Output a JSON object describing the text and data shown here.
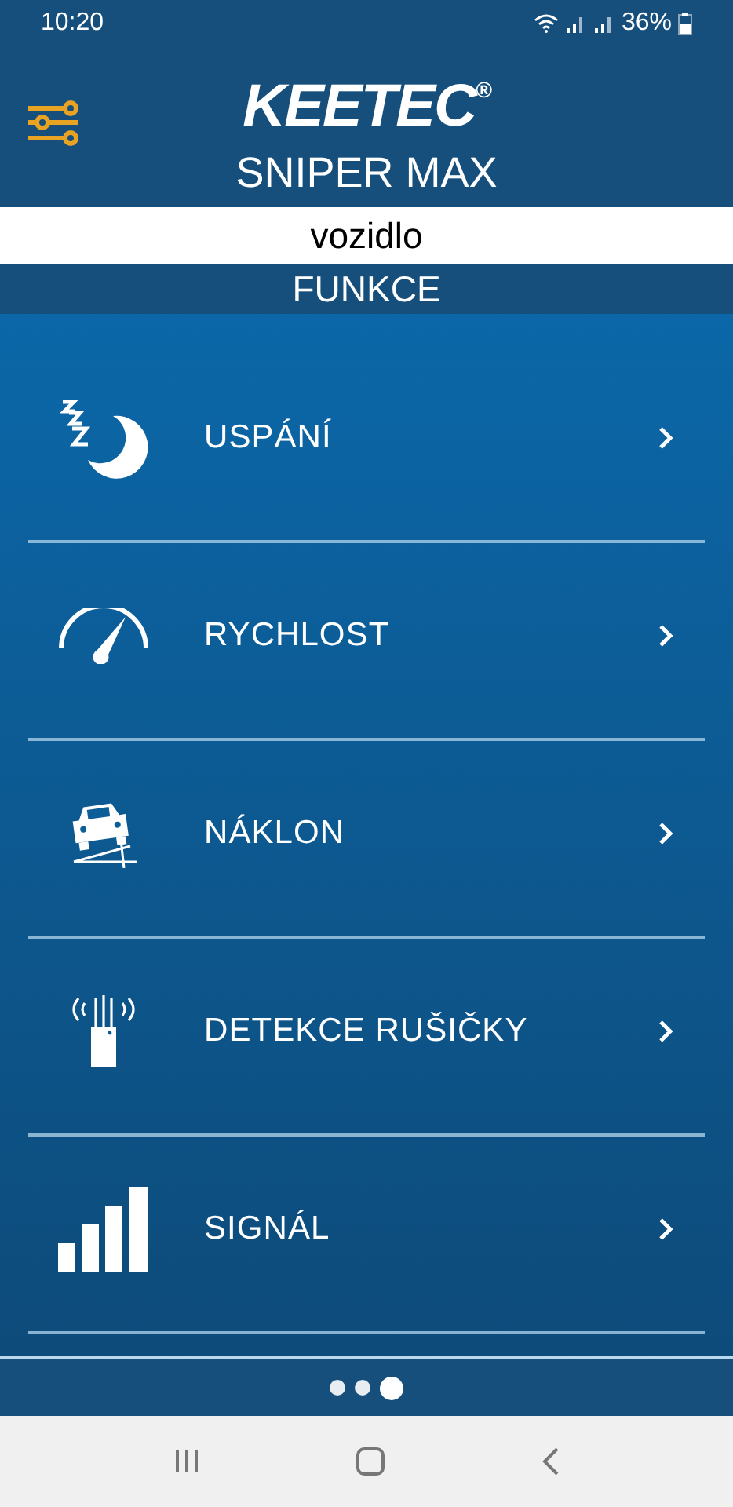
{
  "status_bar": {
    "time": "10:20",
    "battery": "36%"
  },
  "header": {
    "logo": "KEETEC$^{®}$",
    "model": "SNIPER MAX"
  },
  "vehicle": "vozidlo",
  "section_title": "FUNKCE",
  "items": [
    {
      "label": "USPÁNÍ",
      "kind": "sleep"
    },
    {
      "label": "RYCHLOST",
      "kind": "speed"
    },
    {
      "label": "NÁKLON",
      "kind": "tilt"
    },
    {
      "label": "DETEKCE RUŠIČKY",
      "kind": "jammer"
    },
    {
      "label": "SIGNÁL",
      "kind": "signal"
    }
  ],
  "pager": [
    {
      "selected": false
    },
    {
      "selected": false
    },
    {
      "selected": true
    }
  ]
}
